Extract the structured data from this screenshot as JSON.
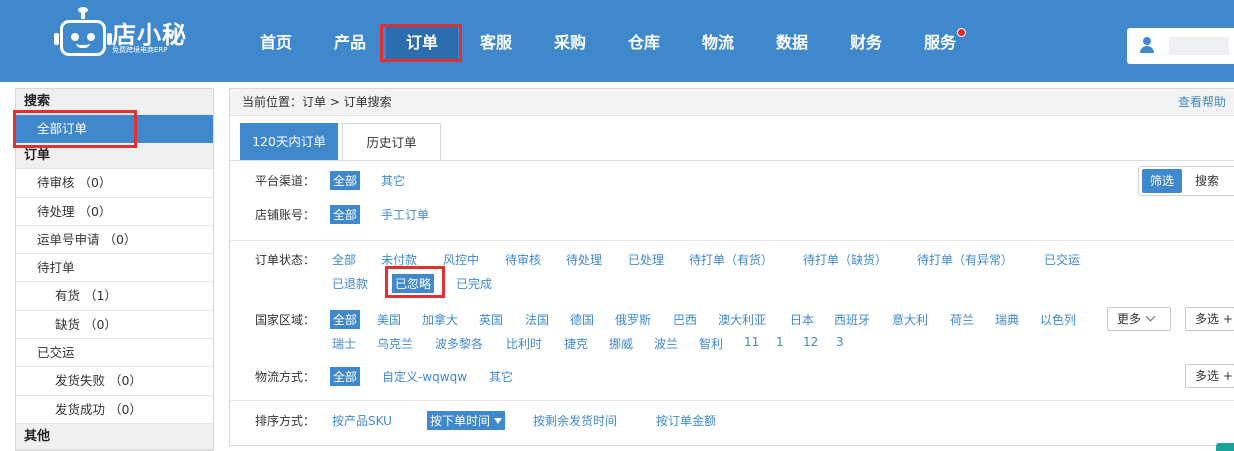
{
  "brand": {
    "name": "店小秘",
    "slogan": "免费跨境电商ERP"
  },
  "nav": {
    "items": [
      "首页",
      "产品",
      "订单",
      "客服",
      "采购",
      "仓库",
      "物流",
      "数据",
      "财务",
      "服务"
    ],
    "active": "订单"
  },
  "sidebar": {
    "search_header": "搜索",
    "all_orders": "全部订单",
    "orders_header": "订单",
    "orders_items": [
      "待审核 （0）",
      "待处理 （0）",
      "运单号申请 （0）",
      "待打单"
    ],
    "pending_print_items": [
      "有货 （1）",
      "缺货 （0）"
    ],
    "shipped": "已交运",
    "shipped_items": [
      "发货失败 （0）",
      "发货成功 （0）"
    ],
    "other_header": "其他"
  },
  "breadcrumb": {
    "text": "当前位置：订单 > 订单搜索",
    "help": "查看帮助"
  },
  "tabs": {
    "active": "120天内订单",
    "inactive": "历史订单"
  },
  "filters": {
    "platform": {
      "label": "平台渠道：",
      "options": [
        "全部",
        "其它"
      ]
    },
    "store": {
      "label": "店铺账号：",
      "options": [
        "全部",
        "手工订单"
      ]
    },
    "status": {
      "label": "订单状态：",
      "row1": [
        "全部",
        "未付款",
        "风控中",
        "待审核",
        "待处理",
        "已处理",
        "待打单（有货）",
        "待打单（缺货）",
        "待打单（有异常）",
        "已交运"
      ],
      "row2": [
        "已退款",
        "已忽略",
        "已完成"
      ],
      "selected": "已忽略"
    },
    "country": {
      "label": "国家区域：",
      "row1": [
        "全部",
        "美国",
        "加拿大",
        "英国",
        "法国",
        "德国",
        "俄罗斯",
        "巴西",
        "澳大利亚",
        "日本",
        "西班牙",
        "意大利",
        "荷兰",
        "瑞典",
        "以色列"
      ],
      "row2": [
        "瑞士",
        "乌克兰",
        "波多黎各",
        "比利时",
        "捷克",
        "挪威",
        "波兰",
        "智利",
        "11",
        "1",
        "12",
        "3"
      ],
      "more": "更多",
      "multi": "多选 +"
    },
    "logistics": {
      "label": "物流方式：",
      "options": [
        "全部",
        "自定义-wqwqw",
        "其它"
      ],
      "multi": "多选 +"
    },
    "sort": {
      "label": "排序方式：",
      "options": [
        "按产品SKU",
        "按下单时间",
        "按剩余发货时间",
        "按订单金额"
      ],
      "selected": "按下单时间"
    }
  },
  "mode_toggle": {
    "filter": "筛选",
    "search": "搜索"
  },
  "colors": {
    "primary": "#3f88cc",
    "highlight": "#e03030"
  }
}
